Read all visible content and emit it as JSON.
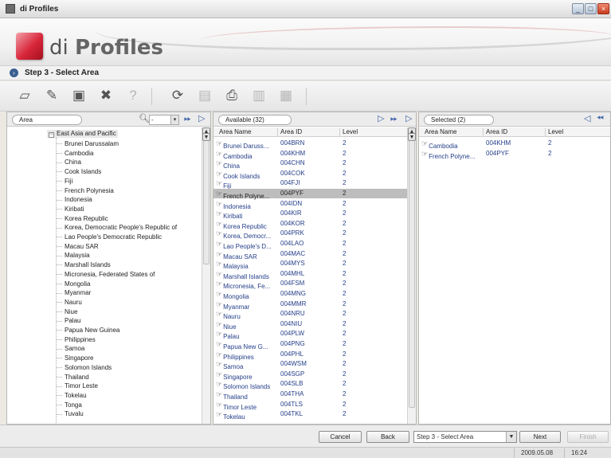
{
  "window": {
    "title": "di Profiles"
  },
  "banner": {
    "logo_prefix": "di",
    "logo_name": "Profiles"
  },
  "step": {
    "title": "Step 3 - Select Area"
  },
  "left_pane": {
    "combo_label": "Area",
    "root": "East Asia and Pacific",
    "items": [
      "Brunei Darussalam",
      "Cambodia",
      "China",
      "Cook Islands",
      "Fiji",
      "French Polynesia",
      "Indonesia",
      "Kiribati",
      "Korea Republic",
      "Korea, Democratic People's Republic of",
      "Lao People's Democratic Republic",
      "Macau SAR",
      "Malaysia",
      "Marshall Islands",
      "Micronesia, Federated States of",
      "Mongolia",
      "Myanmar",
      "Nauru",
      "Niue",
      "Palau",
      "Papua New Guinea",
      "Philippines",
      "Samoa",
      "Singapore",
      "Solomon Islands",
      "Thailand",
      "Timor Leste",
      "Tokelau",
      "Tonga",
      "Tuvalu"
    ]
  },
  "available": {
    "label": "Available (32)",
    "columns": [
      "Area Name",
      "Area ID",
      "Level"
    ],
    "selected_index": 5,
    "rows": [
      [
        "Brunei Daruss...",
        "004BRN",
        "2"
      ],
      [
        "Cambodia",
        "004KHM",
        "2"
      ],
      [
        "China",
        "004CHN",
        "2"
      ],
      [
        "Cook Islands",
        "004COK",
        "2"
      ],
      [
        "Fiji",
        "004FJI",
        "2"
      ],
      [
        "French Polyne...",
        "004PYF",
        "2"
      ],
      [
        "Indonesia",
        "004IDN",
        "2"
      ],
      [
        "Kiribati",
        "004KIR",
        "2"
      ],
      [
        "Korea Republic",
        "004KOR",
        "2"
      ],
      [
        "Korea, Democr...",
        "004PRK",
        "2"
      ],
      [
        "Lao People's D...",
        "004LAO",
        "2"
      ],
      [
        "Macau SAR",
        "004MAC",
        "2"
      ],
      [
        "Malaysia",
        "004MYS",
        "2"
      ],
      [
        "Marshall Islands",
        "004MHL",
        "2"
      ],
      [
        "Micronesia, Fe...",
        "004FSM",
        "2"
      ],
      [
        "Mongolia",
        "004MNG",
        "2"
      ],
      [
        "Myanmar",
        "004MMR",
        "2"
      ],
      [
        "Nauru",
        "004NRU",
        "2"
      ],
      [
        "Niue",
        "004NIU",
        "2"
      ],
      [
        "Palau",
        "004PLW",
        "2"
      ],
      [
        "Papua New G...",
        "004PNG",
        "2"
      ],
      [
        "Philippines",
        "004PHL",
        "2"
      ],
      [
        "Samoa",
        "004WSM",
        "2"
      ],
      [
        "Singapore",
        "004SGP",
        "2"
      ],
      [
        "Solomon Islands",
        "004SLB",
        "2"
      ],
      [
        "Thailand",
        "004THA",
        "2"
      ],
      [
        "Timor Leste",
        "004TLS",
        "2"
      ],
      [
        "Tokelau",
        "004TKL",
        "2"
      ]
    ]
  },
  "selected": {
    "label": "Selected (2)",
    "columns": [
      "Area Name",
      "Area ID",
      "Level"
    ],
    "rows": [
      [
        "Cambodia",
        "004KHM",
        "2"
      ],
      [
        "French Polyne...",
        "004PYF",
        "2"
      ]
    ]
  },
  "buttons": {
    "cancel": "Cancel",
    "back": "Back",
    "next": "Next",
    "finish": "Finish"
  },
  "step_select": {
    "value": "Step 3 - Select Area"
  },
  "status": {
    "date": "2009.05.08",
    "time": "16:24"
  },
  "colors": {
    "link_text": "#26408a",
    "arrow": "#3f63a8",
    "logo_red": "#d8263a"
  }
}
